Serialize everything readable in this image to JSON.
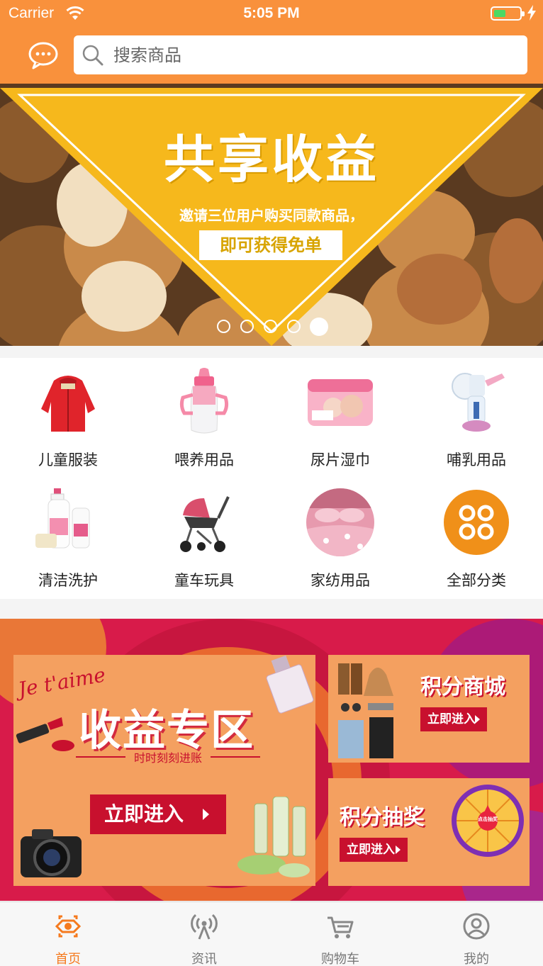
{
  "status_bar": {
    "carrier": "Carrier",
    "time": "5:05 PM",
    "battery_level": 0.45
  },
  "search": {
    "placeholder": "搜索商品"
  },
  "banner": {
    "title": "共享收益",
    "subtitle": "邀请三位用户购买同款商品，",
    "button_text": "即可获得免单",
    "slide_count": 5,
    "active_slide": 5
  },
  "categories": [
    {
      "label": "儿童服装",
      "icon": "kids-jacket-icon"
    },
    {
      "label": "喂养用品",
      "icon": "baby-bottle-icon"
    },
    {
      "label": "尿片湿巾",
      "icon": "diaper-pack-icon"
    },
    {
      "label": "哺乳用品",
      "icon": "breast-pump-icon"
    },
    {
      "label": "清洁洗护",
      "icon": "bath-bottles-icon"
    },
    {
      "label": "童车玩具",
      "icon": "stroller-icon"
    },
    {
      "label": "家纺用品",
      "icon": "bedding-icon"
    },
    {
      "label": "全部分类",
      "icon": "grid-four-icon"
    }
  ],
  "promo": {
    "main": {
      "script_text": "Je t'aime",
      "title": "收益专区",
      "subtitle": "时时刻刻进账",
      "button": "立即进入"
    },
    "points_mall": {
      "title": "积分商城",
      "button": "立即进入"
    },
    "points_lottery": {
      "title": "积分抽奖",
      "button": "立即进入",
      "wheel_text": "点击抽奖"
    }
  },
  "tabbar": {
    "active": "首页",
    "tabs": [
      {
        "label": "首页",
        "icon": "home-icon"
      },
      {
        "label": "资讯",
        "icon": "broadcast-icon"
      },
      {
        "label": "购物车",
        "icon": "cart-icon"
      },
      {
        "label": "我的",
        "icon": "profile-icon"
      }
    ]
  },
  "colors": {
    "brand": "#f9913c",
    "banner_yellow": "#f6b81c",
    "promo_red": "#c8102e",
    "tab_active": "#f57a1e"
  }
}
